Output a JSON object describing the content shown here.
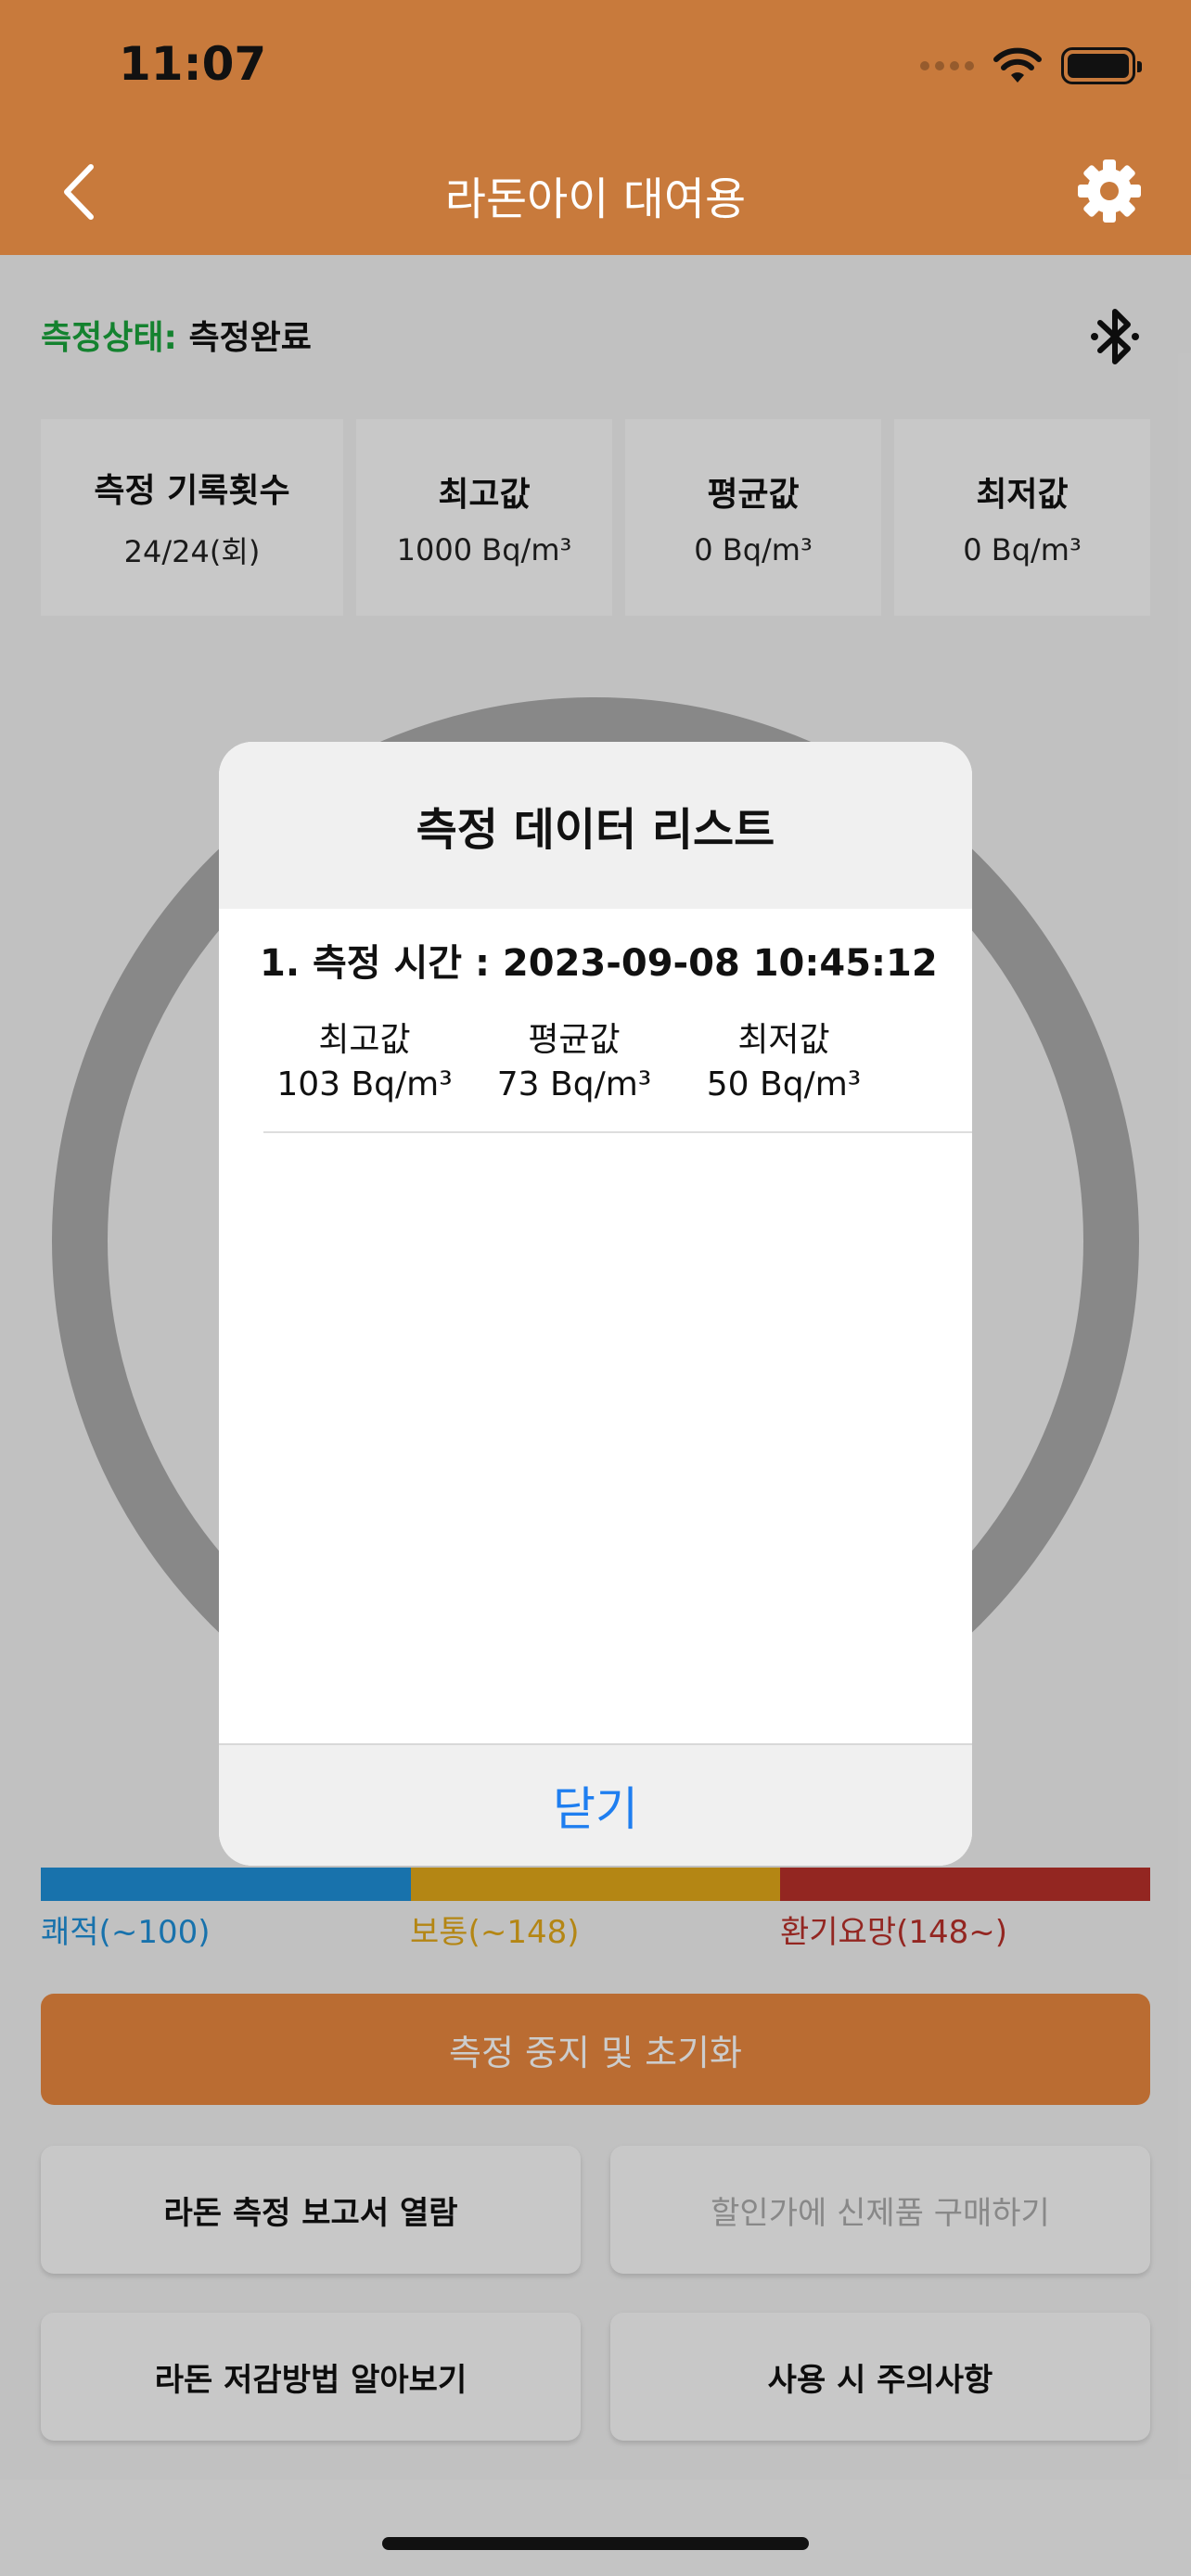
{
  "status_bar": {
    "time": "11:07"
  },
  "nav": {
    "title": "라돈아이 대여용"
  },
  "measure_status": {
    "label": "측정상태:",
    "value": "측정완료"
  },
  "stats": [
    {
      "title": "측정 기록횟수",
      "value": "24/24(회)"
    },
    {
      "title": "최고값",
      "value": "1000 Bq/m³"
    },
    {
      "title": "평균값",
      "value": "0 Bq/m³"
    },
    {
      "title": "최저값",
      "value": "0 Bq/m³"
    }
  ],
  "legend": [
    {
      "label": "쾌적(~100)",
      "color": "#1e8fd8"
    },
    {
      "label": "보통(~148)",
      "color": "#e2a81a"
    },
    {
      "label": "환기요망(148~)",
      "color": "#b8302a"
    }
  ],
  "buttons": {
    "stop_reset": "측정 중지 및 초기화",
    "report": "라돈 측정 보고서 열람",
    "buy": "할인가에 신제품 구매하기",
    "reduce": "라돈 저감방법 알아보기",
    "caution": "사용 시 주의사항"
  },
  "modal": {
    "title": "측정 데이터 리스트",
    "entries": [
      {
        "time": "1. 측정 시간 : 2023-09-08 10:45:12",
        "max_label": "최고값",
        "max_value": "103 Bq/m³",
        "avg_label": "평균값",
        "avg_value": "73 Bq/m³",
        "min_label": "최저값",
        "min_value": "50 Bq/m³"
      }
    ],
    "close": "닫기"
  },
  "colors": {
    "accent": "#c87a3c",
    "button": "#e9883f",
    "link": "#1e7ef0",
    "status_green": "#1aa33b"
  }
}
